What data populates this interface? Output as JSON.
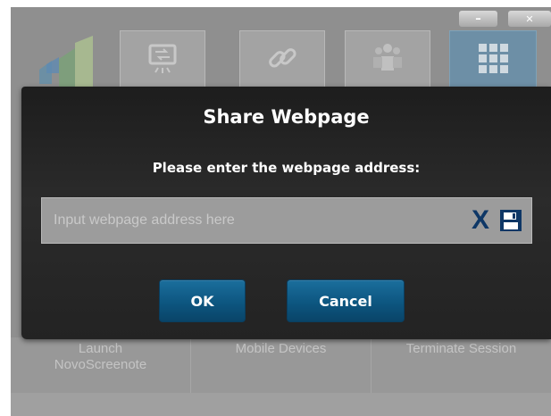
{
  "window": {
    "minimize_label": "–",
    "close_label": "✕"
  },
  "toolbar": {
    "buttons": [
      {
        "icon": "logo-icon"
      },
      {
        "icon": "screen-share-icon"
      },
      {
        "icon": "link-icon"
      },
      {
        "icon": "people-icon"
      },
      {
        "icon": "grid-icon",
        "active": true
      }
    ]
  },
  "bottom_menu": {
    "items": [
      {
        "line1": "Launch",
        "line2": "NovoScreenote"
      },
      {
        "line1": "Mobile Devices",
        "line2": ""
      },
      {
        "line1": "Terminate Session",
        "line2": ""
      }
    ]
  },
  "dialog": {
    "title": "Share Webpage",
    "prompt": "Please enter the webpage address:",
    "url_input": {
      "placeholder": "Input webpage address here",
      "value": ""
    },
    "clear_label": "X",
    "ok_label": "OK",
    "cancel_label": "Cancel"
  },
  "colors": {
    "dialog_bg": "#232323",
    "button_blue": "#0d5680",
    "icon_navy": "#0e3766",
    "active_tile": "#6d8fa6"
  }
}
